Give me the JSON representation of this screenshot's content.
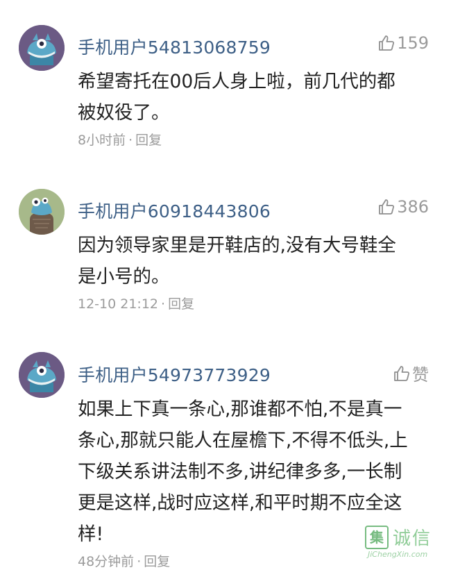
{
  "comments": [
    {
      "username": "手机用户54813068759",
      "likes": "159",
      "lines": [
        "希望寄托在00后人身上啦，前几代的都",
        "被奴役了。"
      ],
      "time": "8小时前",
      "reply": "回复",
      "avatar": "monster-avatar-icon"
    },
    {
      "username": "手机用户60918443806",
      "likes": "386",
      "lines": [
        "因为领导家里是开鞋店的,没有大号鞋全",
        "是小号的。"
      ],
      "time": "12-10 21:12",
      "reply": "回复",
      "avatar": "monster-avatar-icon"
    },
    {
      "username": "手机用户54973773929",
      "likes": "赞",
      "lines": [
        "如果上下真一条心,那谁都不怕,不是真一",
        "条心,那就只能人在屋檐下,不得不低头,上",
        "下级关系讲法制不多,讲纪律多多,一长制",
        "更是这样,战时应这样,和平时期不应全这",
        "样!"
      ],
      "time": "48分钟前",
      "reply": "回复",
      "avatar": "monster-avatar-icon"
    }
  ],
  "meta_separator": "·",
  "watermark": {
    "box_char": "集",
    "cn_text": "诚信",
    "url": "JiChengXin.com"
  },
  "colors": {
    "username": "#3d5f86",
    "text": "#222222",
    "meta": "#9b9b9b",
    "avatar_purple": "#6b5a84",
    "avatar_green": "#a7b98a"
  }
}
